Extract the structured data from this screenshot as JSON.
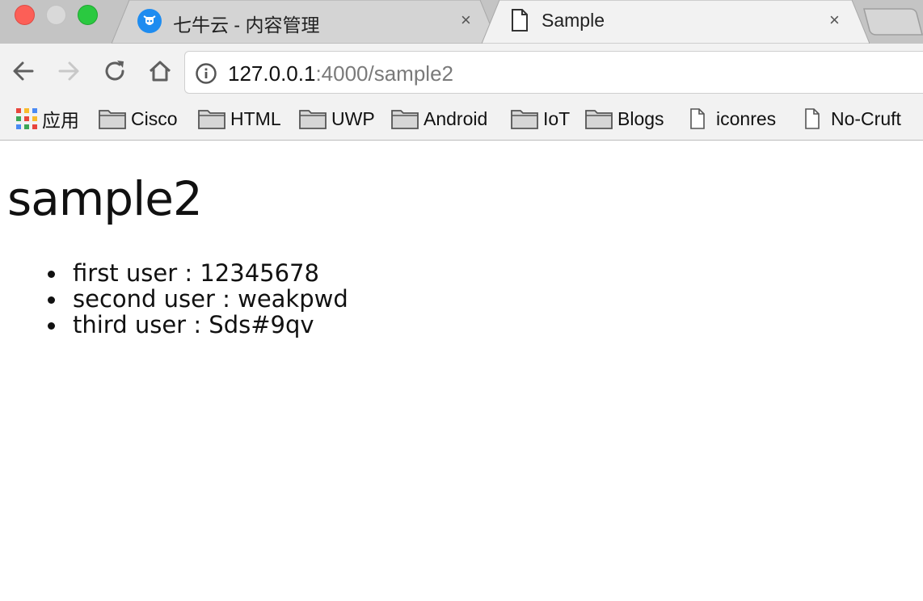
{
  "window": {
    "traffic_lights": [
      "close",
      "minimize",
      "maximize"
    ]
  },
  "tabs": [
    {
      "title": "七牛云 - 内容管理",
      "icon": "qiniu-cow-icon",
      "active": false,
      "close_label": "×"
    },
    {
      "title": "Sample",
      "icon": "document-icon",
      "active": true,
      "close_label": "×"
    }
  ],
  "toolbar": {
    "back_icon": "arrow-left-icon",
    "forward_icon": "arrow-right-icon",
    "reload_icon": "reload-icon",
    "home_icon": "home-icon",
    "url_host": "127.0.0.1",
    "url_path": ":4000/sample2"
  },
  "bookmarks": {
    "apps_label": "应用",
    "items": [
      {
        "label": "Cisco",
        "icon": "folder-icon"
      },
      {
        "label": "HTML",
        "icon": "folder-icon"
      },
      {
        "label": "UWP",
        "icon": "folder-icon"
      },
      {
        "label": "Android",
        "icon": "folder-icon"
      },
      {
        "label": "IoT",
        "icon": "folder-icon"
      },
      {
        "label": "Blogs",
        "icon": "folder-icon"
      },
      {
        "label": "iconres",
        "icon": "page-icon"
      },
      {
        "label": "No-Cruft",
        "icon": "page-icon"
      }
    ]
  },
  "page": {
    "heading": "sample2",
    "users": [
      "first user : 12345678",
      "second user : weakpwd",
      "third user : Sds#9qv"
    ]
  },
  "colors": {
    "tab_strip": "#c4c4c4",
    "toolbar": "#f2f2f2",
    "favicon_blue": "#1e8cf0",
    "close_red": "#fc5f57",
    "maximize_green": "#2ac940"
  }
}
